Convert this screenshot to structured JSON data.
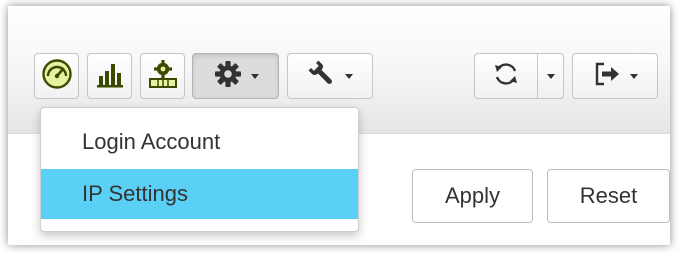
{
  "toolbar": {
    "buttons": [
      {
        "name": "dashboard-button",
        "icon": "speedometer-icon"
      },
      {
        "name": "statistics-button",
        "icon": "bar-chart-icon"
      },
      {
        "name": "device-settings-button",
        "icon": "gear-box-icon"
      },
      {
        "name": "system-settings-button",
        "icon": "gear-icon",
        "has_menu": true,
        "active": true
      },
      {
        "name": "tools-button",
        "icon": "wrench-icon",
        "has_menu": true
      },
      {
        "name": "refresh-button",
        "icon": "refresh-icon",
        "has_menu": true
      },
      {
        "name": "logout-button",
        "icon": "sign-out-icon",
        "has_menu": true
      }
    ]
  },
  "dropdown": {
    "items": [
      {
        "label": "Login Account"
      },
      {
        "label": "IP Settings",
        "highlighted": true
      }
    ],
    "highlight_color": "#5bd0f7"
  },
  "actions": {
    "apply_label": "Apply",
    "reset_label": "Reset"
  },
  "colors": {
    "text": "#333333",
    "accent_dark": "#3a4a00",
    "accent_light": "#e6f2a0"
  }
}
